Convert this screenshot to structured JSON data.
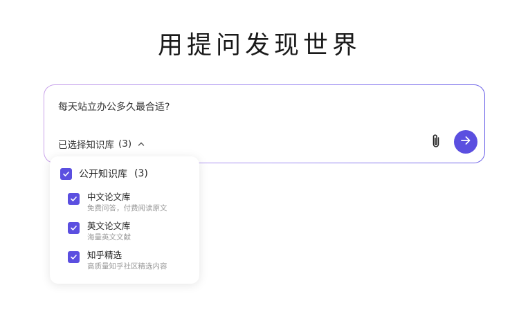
{
  "headline": "用提问发现世界",
  "search": {
    "query": "每天站立办公多久最合适?",
    "kb_label": "已选择知识库",
    "kb_count": "(3)",
    "chevron_icon": "chevron-up-icon",
    "attach_icon": "paperclip-icon",
    "send_icon": "arrow-right-icon"
  },
  "colors": {
    "accent": "#5b4fe0",
    "border_gradient_start": "#c9a2ea",
    "border_gradient_end": "#6a60e8"
  },
  "dropdown": {
    "group": {
      "label": "公开知识库",
      "count": "(3)",
      "checked": true
    },
    "items": [
      {
        "name": "中文论文库",
        "desc": "免费问答，付费阅读原文",
        "checked": true
      },
      {
        "name": "英文论文库",
        "desc": "海量英文文献",
        "checked": true
      },
      {
        "name": "知乎精选",
        "desc": "高质量知乎社区精选内容",
        "checked": true
      }
    ]
  }
}
